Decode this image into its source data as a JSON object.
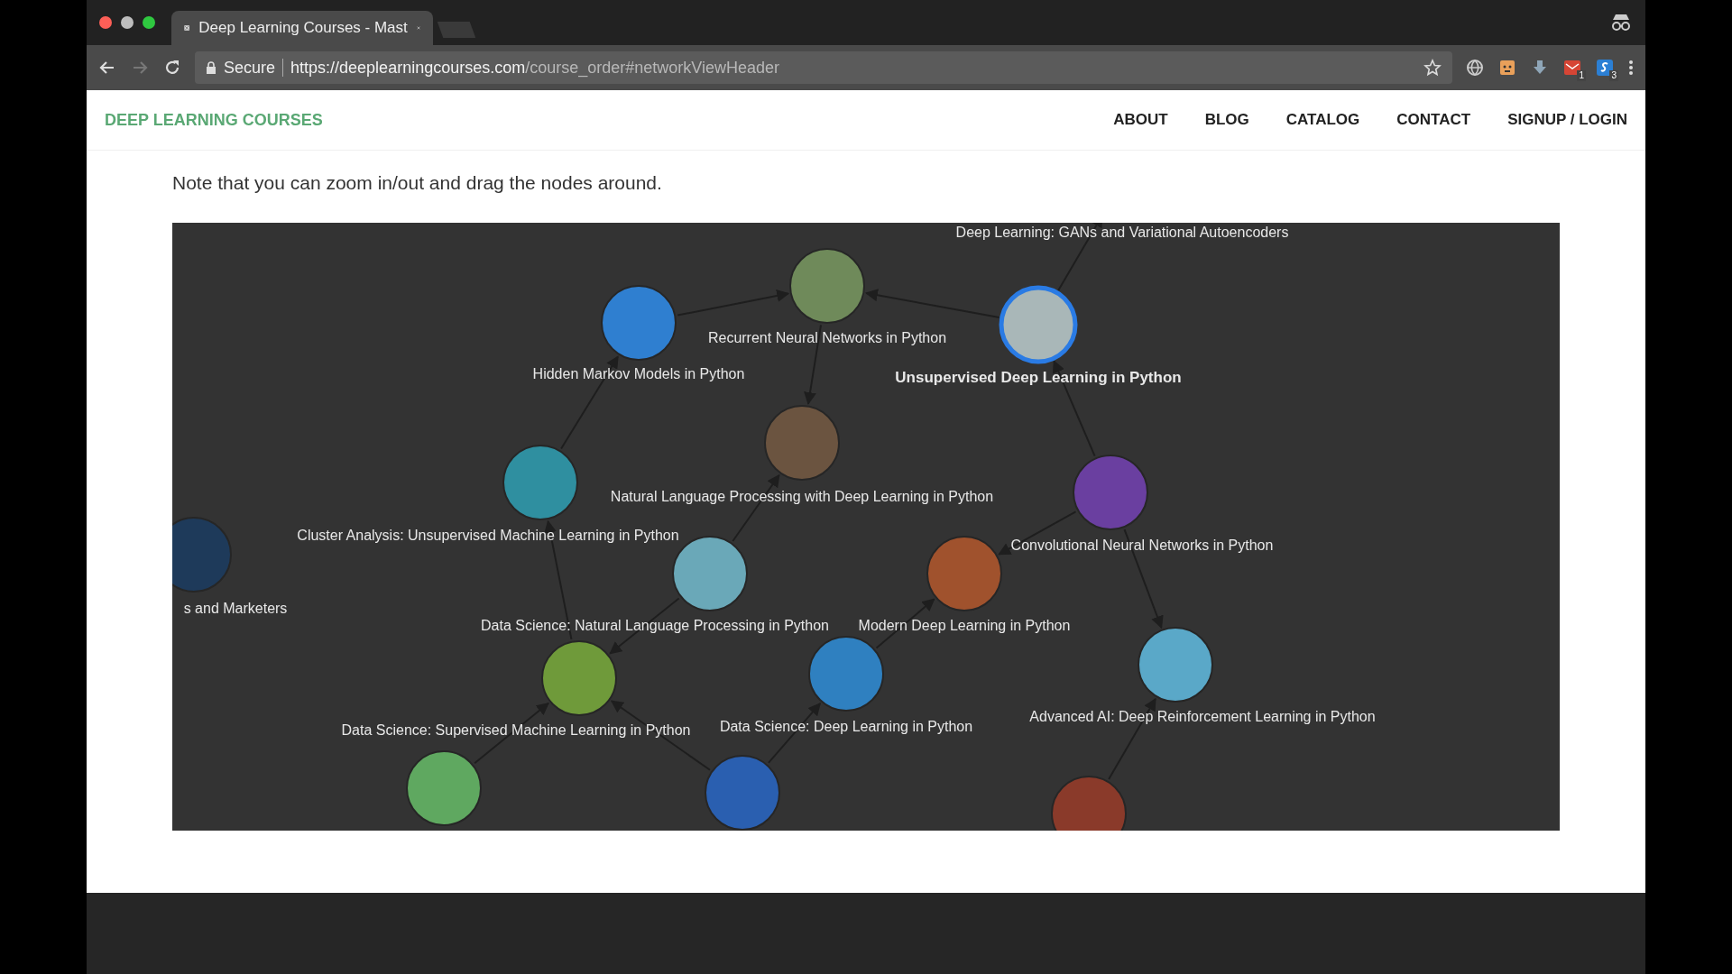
{
  "browser": {
    "tab": {
      "title": "Deep Learning Courses - Mast",
      "selected": true
    },
    "secure_label": "Secure",
    "url_domain": "https://deeplearningcourses.com",
    "url_path": "/course_order#networkViewHeader",
    "extensions": [
      {
        "kind": "globe"
      },
      {
        "kind": "face"
      },
      {
        "kind": "download"
      },
      {
        "kind": "mail",
        "badge": "1"
      },
      {
        "kind": "square",
        "badge": "3"
      }
    ]
  },
  "site": {
    "logo": "DEEP LEARNING COURSES",
    "nav": [
      "ABOUT",
      "BLOG",
      "CATALOG",
      "CONTACT",
      "SIGNUP / LOGIN"
    ]
  },
  "note": "Note that you can zoom in/out and drag the nodes around.",
  "graph": {
    "nodes": [
      {
        "label": "Deep Learning: GANs and Variational Autoencoders"
      },
      {
        "label": "Hidden Markov Models in Python",
        "selected": false
      },
      {
        "label": "Recurrent Neural Networks in Python",
        "selected": false
      },
      {
        "label": "Unsupervised Deep Learning in Python",
        "selected": true
      },
      {
        "label": "Natural Language Processing with Deep Learning in Python",
        "selected": false
      },
      {
        "label": "Cluster Analysis: Unsupervised Machine Learning in Python",
        "selected": false
      },
      {
        "label": "Convolutional Neural Networks in Python",
        "selected": false
      },
      {
        "label": "s and Marketers",
        "selected": false
      },
      {
        "label": "Data Science: Natural Language Processing in Python",
        "selected": false
      },
      {
        "label": "Modern Deep Learning in Python",
        "selected": false
      },
      {
        "label": "Advanced AI: Deep Reinforcement Learning in Python",
        "selected": false
      },
      {
        "label": "Data Science: Supervised Machine Learning in Python",
        "selected": false
      },
      {
        "label": "Data Science: Deep Learning in Python",
        "selected": false
      },
      {
        "selected": false
      },
      {
        "selected": false
      },
      {
        "selected": false
      }
    ]
  }
}
